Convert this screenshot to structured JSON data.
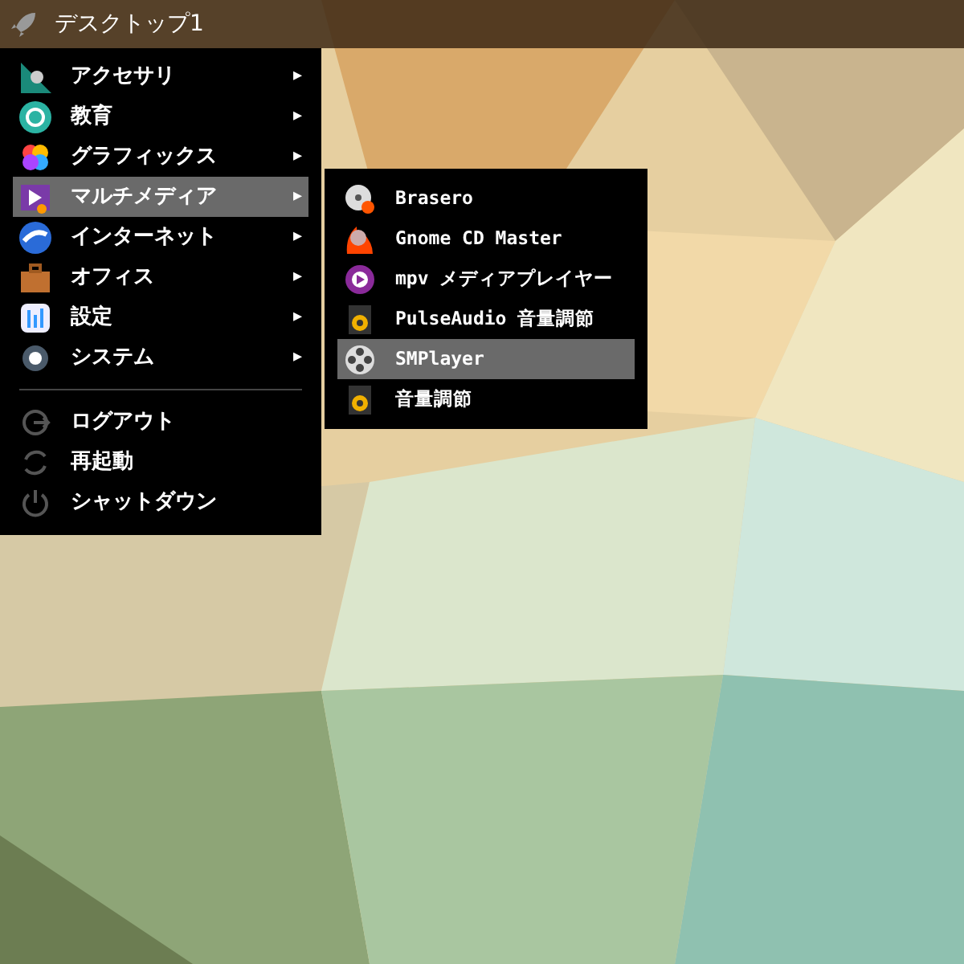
{
  "taskbar": {
    "title": "デスクトップ1"
  },
  "menu": {
    "items": [
      {
        "kind": "category",
        "label": "アクセサリ",
        "arrow": "▸",
        "selected": false
      },
      {
        "kind": "category",
        "label": "教育",
        "arrow": "▸",
        "selected": false
      },
      {
        "kind": "category",
        "label": "グラフィックス",
        "arrow": "▸",
        "selected": false
      },
      {
        "kind": "category",
        "label": "マルチメディア",
        "arrow": "▸",
        "selected": true
      },
      {
        "kind": "category",
        "label": "インターネット",
        "arrow": "▸",
        "selected": false
      },
      {
        "kind": "category",
        "label": "オフィス",
        "arrow": "▸",
        "selected": false
      },
      {
        "kind": "category",
        "label": "設定",
        "arrow": "▸",
        "selected": false
      },
      {
        "kind": "category",
        "label": "システム",
        "arrow": "▸",
        "selected": false
      },
      {
        "kind": "separator"
      },
      {
        "kind": "action",
        "label": "ログアウト",
        "selected": false
      },
      {
        "kind": "action",
        "label": "再起動",
        "selected": false
      },
      {
        "kind": "action",
        "label": "シャットダウン",
        "selected": false
      }
    ]
  },
  "submenu": {
    "items": [
      {
        "label": "Brasero",
        "selected": false
      },
      {
        "label": "Gnome CD Master",
        "selected": false
      },
      {
        "label": "mpv メディアプレイヤー",
        "selected": false
      },
      {
        "label": "PulseAudio 音量調節",
        "selected": false
      },
      {
        "label": "SMPlayer",
        "selected": true
      },
      {
        "label": "音量調節",
        "selected": false
      }
    ]
  }
}
